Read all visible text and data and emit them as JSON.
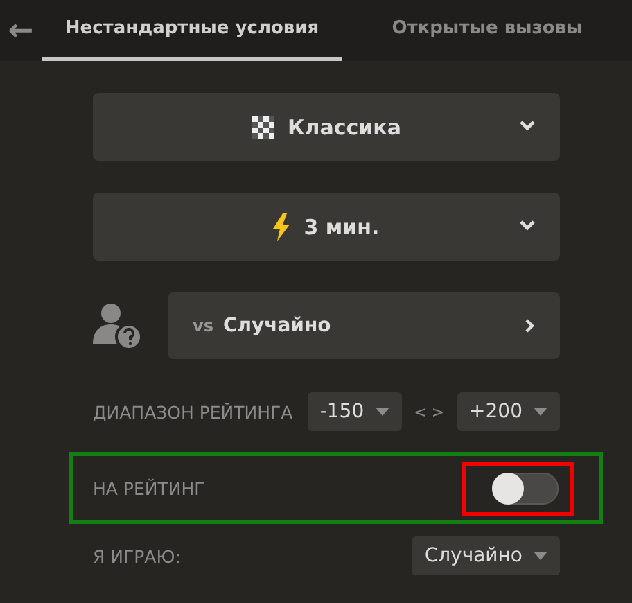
{
  "header": {
    "back": "←",
    "tabs": [
      {
        "label": "Нестандартные условия",
        "selected": true
      },
      {
        "label": "Открытые вызовы",
        "selected": false
      }
    ]
  },
  "variant": {
    "label": "Классика",
    "kind": "board"
  },
  "time": {
    "label": "3 мин.",
    "kind": "bolt"
  },
  "opponent": {
    "prefix": "vs",
    "value": "Случайно"
  },
  "rating_range": {
    "label": "ДИАПАЗОН РЕЙТИНГА",
    "min": "-150",
    "separator": "< >",
    "max": "+200"
  },
  "rated": {
    "label": "НА РЕЙТИНГ",
    "on": false
  },
  "color": {
    "label": "Я ИГРАЮ:",
    "value": "Случайно"
  }
}
